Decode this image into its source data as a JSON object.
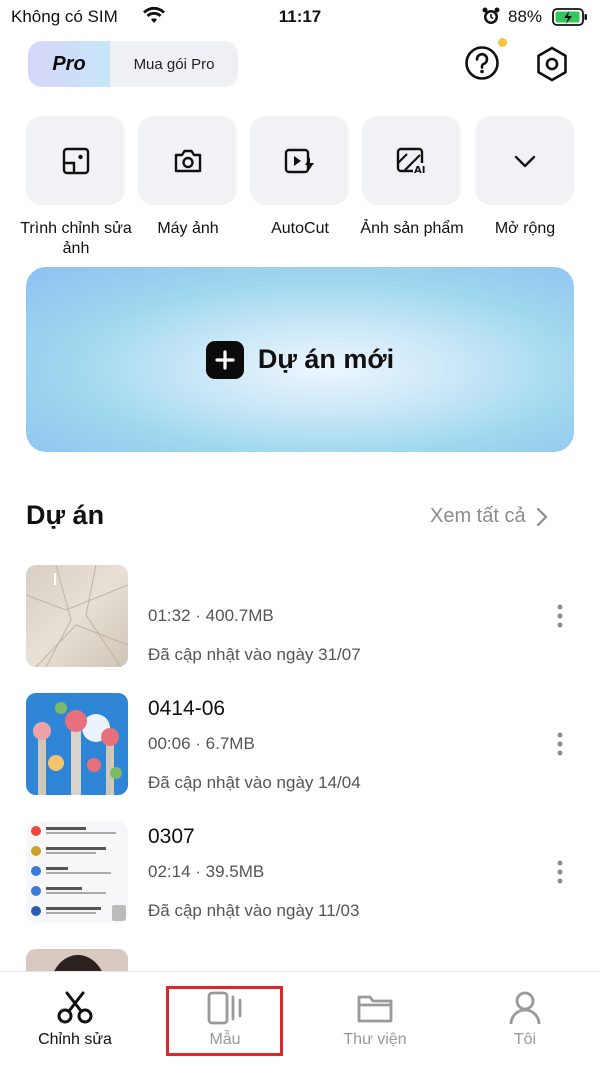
{
  "status_bar": {
    "carrier": "Không có SIM",
    "time": "11:17",
    "battery_percent": "88%",
    "icons": [
      "wifi-icon",
      "alarm-icon",
      "battery-charging-icon"
    ]
  },
  "header": {
    "pro_badge": "Pro",
    "pro_label": "Mua gói Pro",
    "help_icon": "help-icon",
    "settings_icon": "settings-icon",
    "notification_dot_color": "#f4c542"
  },
  "tools": [
    {
      "label": "Trình chỉnh sửa ảnh",
      "icon": "photo-editor-icon"
    },
    {
      "label": "Máy ảnh",
      "icon": "camera-icon"
    },
    {
      "label": "AutoCut",
      "icon": "autocut-icon"
    },
    {
      "label": "Ảnh sản phẩm",
      "icon": "ai-product-photo-icon"
    },
    {
      "label": "Mở rộng",
      "icon": "chevron-down-icon"
    }
  ],
  "new_project": {
    "label": "Dự án mới",
    "icon": "plus-icon"
  },
  "projects_section": {
    "title": "Dự án",
    "see_all": "Xem tất cả"
  },
  "projects": [
    {
      "name": "",
      "duration": "01:32",
      "size": "400.7MB",
      "updated": "Đã cập nhật vào ngày 31/07"
    },
    {
      "name": "0414-06",
      "duration": "00:06",
      "size": "6.7MB",
      "updated": "Đã cập nhật vào ngày 14/04"
    },
    {
      "name": "0307",
      "duration": "02:14",
      "size": "39.5MB",
      "updated": "Đã cập nhật vào ngày 11/03"
    }
  ],
  "tabbar": {
    "tabs": [
      {
        "label": "Chỉnh sửa",
        "icon": "scissors-icon",
        "active": true
      },
      {
        "label": "Mẫu",
        "icon": "template-icon",
        "active": false
      },
      {
        "label": "Thư viện",
        "icon": "folder-icon",
        "active": false
      },
      {
        "label": "Tôi",
        "icon": "profile-icon",
        "active": false
      }
    ]
  },
  "colors": {
    "highlight": "#e0262b",
    "accent_dark": "#0b0b0b"
  }
}
